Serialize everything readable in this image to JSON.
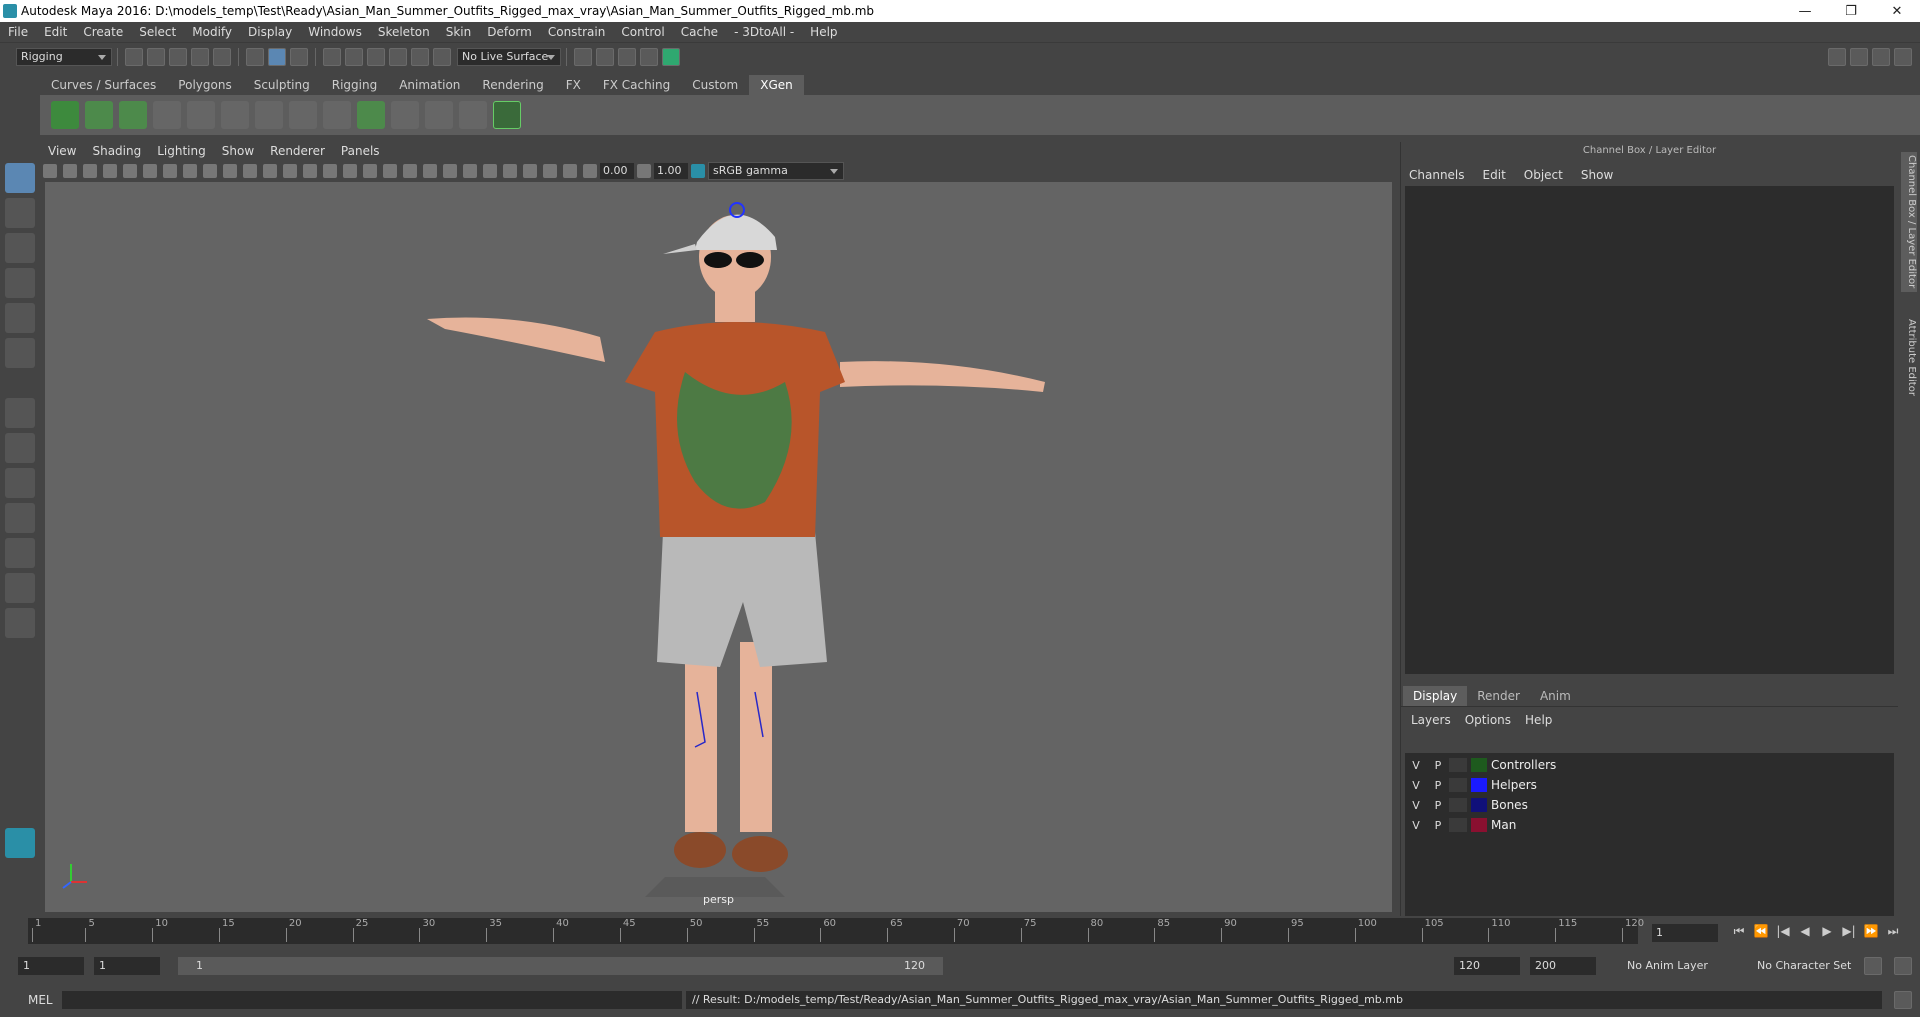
{
  "window": {
    "title": "Autodesk Maya 2016: D:\\models_temp\\Test\\Ready\\Asian_Man_Summer_Outfits_Rigged_max_vray\\Asian_Man_Summer_Outfits_Rigged_mb.mb",
    "minimize": "—",
    "restore": "❐",
    "close": "✕"
  },
  "menubar": [
    "File",
    "Edit",
    "Create",
    "Select",
    "Modify",
    "Display",
    "Windows",
    "Skeleton",
    "Skin",
    "Deform",
    "Constrain",
    "Control",
    "Cache",
    "- 3DtoAll -",
    "Help"
  ],
  "statusline": {
    "menuset": "Rigging",
    "live_surface": "No Live Surface"
  },
  "shelf": {
    "tabs": [
      "Curves / Surfaces",
      "Polygons",
      "Sculpting",
      "Rigging",
      "Animation",
      "Rendering",
      "FX",
      "FX Caching",
      "Custom",
      "XGen"
    ],
    "active_tab": "XGen"
  },
  "panel": {
    "menu": [
      "View",
      "Shading",
      "Lighting",
      "Show",
      "Renderer",
      "Panels"
    ],
    "exposure": "0.00",
    "gamma": "1.00",
    "color_space": "sRGB gamma",
    "camera_label": "persp"
  },
  "channelbox": {
    "title": "Channel Box / Layer Editor",
    "menu": [
      "Channels",
      "Edit",
      "Object",
      "Show"
    ]
  },
  "layer_editor": {
    "tabs": [
      "Display",
      "Render",
      "Anim"
    ],
    "active_tab": "Display",
    "menu": [
      "Layers",
      "Options",
      "Help"
    ],
    "layers": [
      {
        "v": "V",
        "p": "P",
        "name": "Controllers",
        "color": "#1e5a1e"
      },
      {
        "v": "V",
        "p": "P",
        "name": "Helpers",
        "color": "#1a1aff"
      },
      {
        "v": "V",
        "p": "P",
        "name": "Bones",
        "color": "#10107a"
      },
      {
        "v": "V",
        "p": "P",
        "name": "Man",
        "color": "#8a1030"
      }
    ]
  },
  "side_tabs": [
    "Channel Box / Layer Editor",
    "Attribute Editor"
  ],
  "timeline": {
    "ticks": [
      "1",
      "5",
      "10",
      "15",
      "20",
      "25",
      "30",
      "35",
      "40",
      "45",
      "50",
      "55",
      "60",
      "65",
      "70",
      "75",
      "80",
      "85",
      "90",
      "95",
      "100",
      "105",
      "110",
      "115",
      "120"
    ],
    "current_frame": "1",
    "controls": [
      "⏮",
      "⏪",
      "|◀",
      "◀",
      "▶",
      "▶|",
      "⏩",
      "⏭"
    ]
  },
  "range": {
    "start": "1",
    "playback_start": "1",
    "slider_start": "1",
    "slider_end": "120",
    "playback_end": "120",
    "end": "200",
    "anim_layer": "No Anim Layer",
    "character_set": "No Character Set"
  },
  "command": {
    "language": "MEL",
    "result": "// Result: D:/models_temp/Test/Ready/Asian_Man_Summer_Outfits_Rigged_max_vray/Asian_Man_Summer_Outfits_Rigged_mb.mb"
  }
}
